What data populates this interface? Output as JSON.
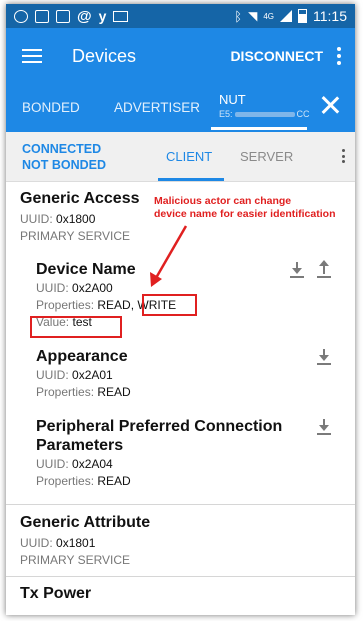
{
  "status_bar": {
    "time": "11:15",
    "network": "4G"
  },
  "app_bar": {
    "title": "Devices",
    "disconnect_label": "DISCONNECT"
  },
  "tabs": {
    "bonded": "BONDED",
    "advertiser": "ADVERTISER",
    "device_name": "NUT",
    "device_addr_start": "E5:",
    "device_addr_end": "CC"
  },
  "sub_bar": {
    "status1": "CONNECTED",
    "status2": "NOT BONDED",
    "client": "CLIENT",
    "server": "SERVER"
  },
  "services": [
    {
      "name": "Generic Access",
      "uuid_label": "UUID:",
      "uuid": "0x1800",
      "type": "PRIMARY SERVICE",
      "characteristics": [
        {
          "name": "Device Name",
          "uuid_label": "UUID:",
          "uuid": "0x2A00",
          "props_label": "Properties:",
          "props_a": "READ,",
          "props_b": "WRITE",
          "value_label": "Value:",
          "value": "test"
        },
        {
          "name": "Appearance",
          "uuid_label": "UUID:",
          "uuid": "0x2A01",
          "props_label": "Properties:",
          "props": "READ"
        },
        {
          "name_line1": "Peripheral Preferred Connection",
          "name_line2": "Parameters",
          "uuid_label": "UUID:",
          "uuid": "0x2A04",
          "props_label": "Properties:",
          "props": "READ"
        }
      ]
    },
    {
      "name": "Generic Attribute",
      "uuid_label": "UUID:",
      "uuid": "0x1801",
      "type": "PRIMARY SERVICE"
    },
    {
      "name": "Tx Power"
    }
  ],
  "annotation": {
    "line1": "Malicious actor can change",
    "line2": "device name for easier identification"
  },
  "colors": {
    "primary": "#1e88e5",
    "status_bar": "#1565a7",
    "annotation": "#e02020"
  }
}
